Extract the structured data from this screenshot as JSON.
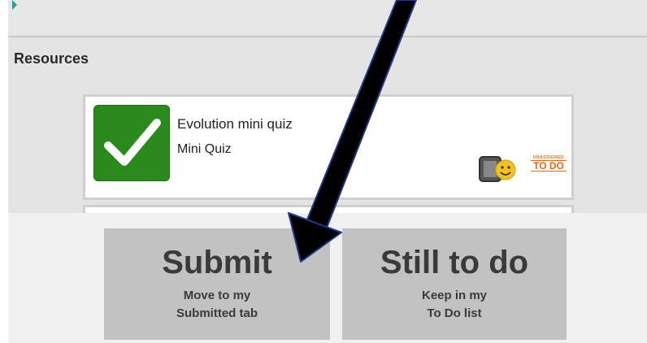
{
  "section": {
    "title": "Resources"
  },
  "resource_card": {
    "title": "Evolution mini quiz",
    "type": "Mini Quiz",
    "status_icon": "checkmark-icon",
    "device_icon": "tablet-smiley-icon",
    "badge_small": "UNASSIGNED",
    "badge_main": "TO DO"
  },
  "actions": {
    "submit": {
      "title": "Submit",
      "line1": "Move to my",
      "line2": "Submitted tab"
    },
    "still_to_do": {
      "title": "Still to do",
      "line1": "Keep in my",
      "line2": "To Do list"
    }
  },
  "colors": {
    "check_green": "#2a8a1c",
    "button_gray": "#c2c2c2",
    "todo_orange": "#e56a12",
    "arrow_blue": "#1f3a8a"
  }
}
